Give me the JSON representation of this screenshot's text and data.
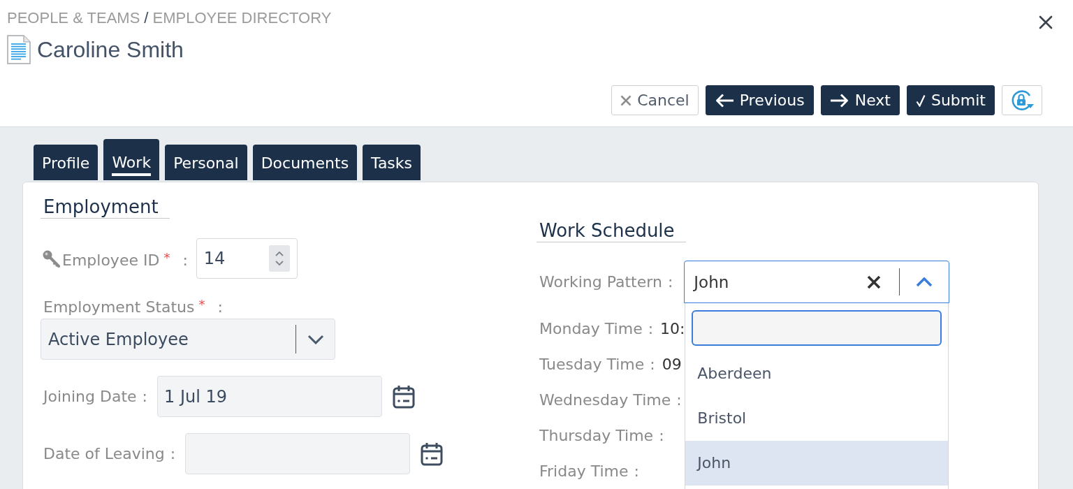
{
  "breadcrumb": {
    "items": [
      "PEOPLE & TEAMS",
      "EMPLOYEE DIRECTORY"
    ],
    "separator": "/"
  },
  "title": "Caroline Smith",
  "actions": [
    {
      "kind": "cancel",
      "label": "Cancel"
    },
    {
      "kind": "previous",
      "label": "Previous"
    },
    {
      "kind": "next",
      "label": "Next"
    },
    {
      "kind": "submit",
      "label": "Submit"
    },
    {
      "kind": "lock"
    }
  ],
  "tabs": [
    {
      "label": "Profile",
      "selected": false
    },
    {
      "label": "Work",
      "selected": true
    },
    {
      "label": "Personal",
      "selected": false
    },
    {
      "label": "Documents",
      "selected": false
    },
    {
      "label": "Tasks",
      "selected": false
    }
  ],
  "employment": {
    "heading": "Employment",
    "fields": [
      {
        "kind": "id",
        "label": "Employee ID",
        "required_mark": "*",
        "separator": ":",
        "value": "14"
      },
      {
        "kind": "select",
        "label": "Employment Status",
        "required_mark": "*",
        "separator": ":",
        "value": "Active Employee"
      },
      {
        "kind": "date",
        "label": "Joining Date",
        "separator": ":",
        "value": "1 Jul 19"
      },
      {
        "kind": "date",
        "label": "Date of Leaving",
        "separator": ":"
      }
    ]
  },
  "work_schedule": {
    "heading": "Work Schedule",
    "working_pattern": {
      "label": "Working Pattern",
      "separator": ":",
      "value": "John",
      "expanded": true,
      "options": [
        {
          "label": "Aberdeen",
          "selected": false
        },
        {
          "label": "Bristol",
          "selected": false
        },
        {
          "label": "John",
          "selected": true
        }
      ]
    },
    "days": [
      {
        "label": "Monday Time",
        "separator": ":",
        "value": "10:"
      },
      {
        "label": "Tuesday Time",
        "separator": ":",
        "value": "09"
      },
      {
        "label": "Wednesday Time",
        "separator": ":"
      },
      {
        "label": "Thursday Time",
        "separator": ":"
      },
      {
        "label": "Friday Time",
        "separator": ":"
      }
    ]
  }
}
